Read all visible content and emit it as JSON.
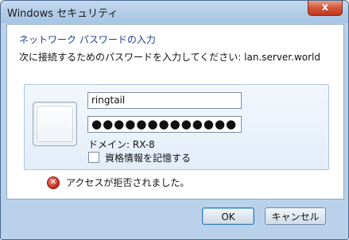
{
  "window": {
    "title": "Windows セキュリティ",
    "close_label": "x"
  },
  "dialog": {
    "heading": "ネットワーク パスワードの入力",
    "description": "次に接続するためのパスワードを入力してください: lan.server.world"
  },
  "credentials": {
    "username": "ringtail",
    "password_mask": "●●●●●●●●●●●●●",
    "domain_label": "ドメイン: RX-8",
    "remember_label": "資格情報を記憶する",
    "remember_checked": false
  },
  "error": {
    "message": "アクセスが拒否されました。"
  },
  "buttons": {
    "ok": "OK",
    "cancel": "キャンセル"
  },
  "colors": {
    "heading": "#1f3f8f",
    "frame": "#b9d1ea",
    "close": "#c1391c"
  }
}
